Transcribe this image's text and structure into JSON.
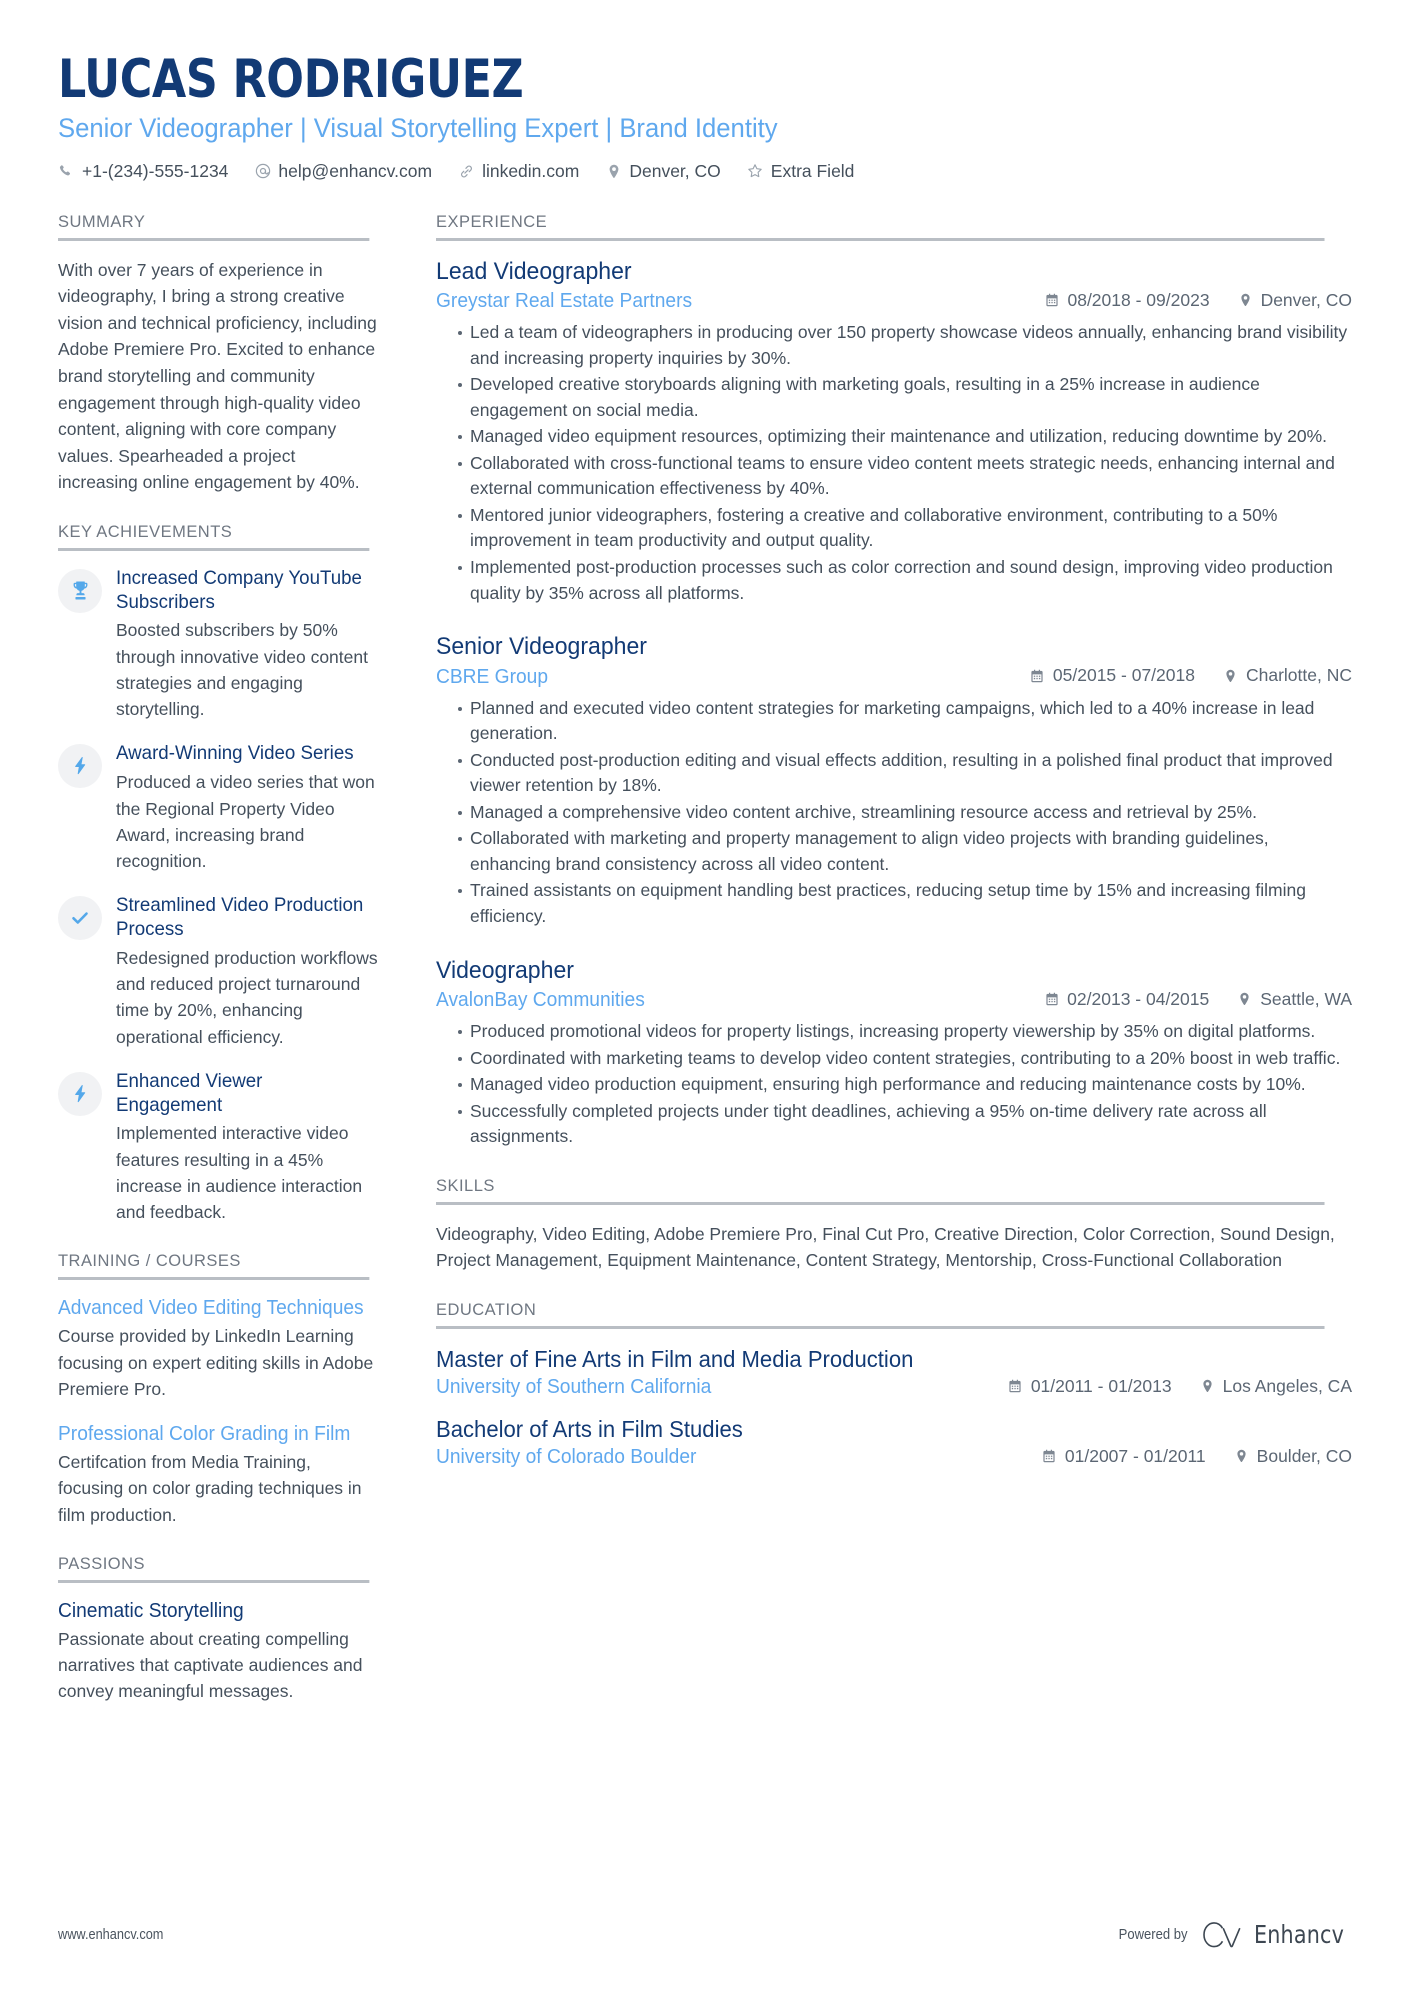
{
  "colors": {
    "navy": "#123a75",
    "light_blue": "#5fa8ee",
    "body_gray": "#45505c",
    "rule_gray": "#b9bec4",
    "icon_gray": "#9aa3ad"
  },
  "header": {
    "name": "LUCAS RODRIGUEZ",
    "title": "Senior Videographer | Visual Storytelling Expert | Brand Identity",
    "contacts": [
      {
        "icon": "phone-icon",
        "text": "+1-(234)-555-1234"
      },
      {
        "icon": "email-icon",
        "text": "help@enhancv.com"
      },
      {
        "icon": "link-icon",
        "text": "linkedin.com"
      },
      {
        "icon": "location-pin-icon",
        "text": "Denver, CO"
      },
      {
        "icon": "star-icon",
        "text": "Extra Field"
      }
    ]
  },
  "summary": {
    "heading": "SUMMARY",
    "text": "With over 7 years of experience in videography, I bring a strong creative vision and technical proficiency, including Adobe Premiere Pro. Excited to enhance brand storytelling and community engagement through high-quality video content, aligning with core company values. Spearheaded a project increasing online engagement by 40%."
  },
  "key_achievements": {
    "heading": "KEY ACHIEVEMENTS",
    "items": [
      {
        "icon": "trophy-icon",
        "title": "Increased Company YouTube Subscribers",
        "description": "Boosted subscribers by 50% through innovative video content strategies and engaging storytelling."
      },
      {
        "icon": "lightning-bolt-icon",
        "title": "Award-Winning Video Series",
        "description": "Produced a video series that won the Regional Property Video Award, increasing brand recognition."
      },
      {
        "icon": "checkmark-icon",
        "title": "Streamlined Video Production Process",
        "description": "Redesigned production workflows and reduced project turnaround time by 20%, enhancing operational efficiency."
      },
      {
        "icon": "lightning-bolt-icon",
        "title": "Enhanced Viewer Engagement",
        "description": "Implemented interactive video features resulting in a 45% increase in audience interaction and feedback."
      }
    ]
  },
  "training": {
    "heading": "TRAINING / COURSES",
    "items": [
      {
        "title": "Advanced Video Editing Techniques",
        "description": "Course provided by LinkedIn Learning focusing on expert editing skills in Adobe Premiere Pro."
      },
      {
        "title": "Professional Color Grading in Film",
        "description": "Certifcation from Media Training, focusing on color grading techniques in film production."
      }
    ]
  },
  "passions": {
    "heading": "PASSIONS",
    "items": [
      {
        "title": "Cinematic Storytelling",
        "description": "Passionate about creating compelling narratives that captivate audiences and convey meaningful messages."
      }
    ]
  },
  "experience": {
    "heading": "EXPERIENCE",
    "jobs": [
      {
        "title": "Lead Videographer",
        "company": "Greystar Real Estate Partners",
        "dates": "08/2018 - 09/2023",
        "location": "Denver, CO",
        "bullets": [
          "Led a team of videographers in producing over 150 property showcase videos annually, enhancing brand visibility and increasing property inquiries by 30%.",
          "Developed creative storyboards aligning with marketing goals, resulting in a 25% increase in audience engagement on social media.",
          "Managed video equipment resources, optimizing their maintenance and utilization, reducing downtime by 20%.",
          "Collaborated with cross-functional teams to ensure video content meets strategic needs, enhancing internal and external communication effectiveness by 40%.",
          "Mentored junior videographers, fostering a creative and collaborative environment, contributing to a 50% improvement in team productivity and output quality.",
          "Implemented post-production processes such as color correction and sound design, improving video production quality by 35% across all platforms."
        ]
      },
      {
        "title": "Senior Videographer",
        "company": "CBRE Group",
        "dates": "05/2015 - 07/2018",
        "location": "Charlotte, NC",
        "bullets": [
          "Planned and executed video content strategies for marketing campaigns, which led to a 40% increase in lead generation.",
          "Conducted post-production editing and visual effects addition, resulting in a polished final product that improved viewer retention by 18%.",
          "Managed a comprehensive video content archive, streamlining resource access and retrieval by 25%.",
          "Collaborated with marketing and property management to align video projects with branding guidelines, enhancing brand consistency across all video content.",
          "Trained assistants on equipment handling best practices, reducing setup time by 15% and increasing filming efficiency."
        ]
      },
      {
        "title": "Videographer",
        "company": "AvalonBay Communities",
        "dates": "02/2013 - 04/2015",
        "location": "Seattle, WA",
        "bullets": [
          "Produced promotional videos for property listings, increasing property viewership by 35% on digital platforms.",
          "Coordinated with marketing teams to develop video content strategies, contributing to a 20% boost in web traffic.",
          "Managed video production equipment, ensuring high performance and reducing maintenance costs by 10%.",
          "Successfully completed projects under tight deadlines, achieving a 95% on-time delivery rate across all assignments."
        ]
      }
    ]
  },
  "skills": {
    "heading": "SKILLS",
    "text": "Videography, Video Editing, Adobe Premiere Pro, Final Cut Pro, Creative Direction, Color Correction, Sound Design, Project Management, Equipment Maintenance, Content Strategy, Mentorship, Cross-Functional Collaboration"
  },
  "education": {
    "heading": "EDUCATION",
    "items": [
      {
        "degree": "Master of Fine Arts in Film and Media Production",
        "school": "University of Southern California",
        "dates": "01/2011 - 01/2013",
        "location": "Los Angeles, CA"
      },
      {
        "degree": "Bachelor of Arts in Film Studies",
        "school": "University of Colorado Boulder",
        "dates": "01/2007 - 01/2011",
        "location": "Boulder, CO"
      }
    ]
  },
  "footer": {
    "url": "www.enhancv.com",
    "powered_by": "Powered by",
    "brand": "Enhancv"
  }
}
